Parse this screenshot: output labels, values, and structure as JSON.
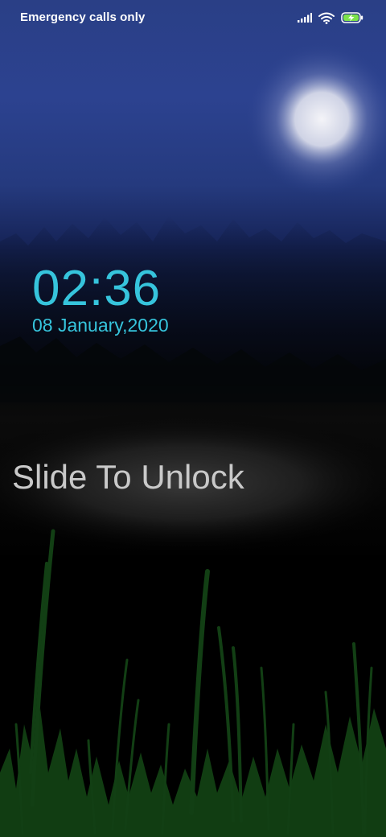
{
  "status_bar": {
    "carrier": "Emergency calls only",
    "icons": [
      "signal-icon",
      "wifi-icon",
      "battery-charging-icon"
    ],
    "battery_color": "#7ce34a"
  },
  "lock_clock": {
    "time": "02:36",
    "date": "08 January,2020",
    "color": "#36c4dc"
  },
  "unlock": {
    "label": "Slide To Unlock"
  }
}
